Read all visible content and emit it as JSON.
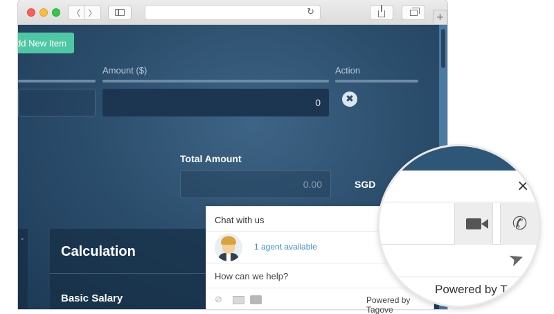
{
  "browser": {
    "nav_back_glyph": "〈",
    "nav_forward_glyph": "〉",
    "reload_glyph": "↻",
    "new_tab_glyph": "+"
  },
  "page": {
    "add_button_label": "dd New Item",
    "columns": {
      "amount_label": "Amount ($)",
      "action_label": "Action"
    },
    "amount_value": "0",
    "remove_icon_glyph": "✖",
    "total_label": "Total Amount",
    "total_value": "0.00",
    "currency": "SGD",
    "calc_title": "Calculation",
    "basic_salary_label": "Basic Salary",
    "panel_arrow_glyph": "⌄"
  },
  "chat": {
    "title": "Chat with us",
    "agent_status": "1 agent available",
    "help_prompt": "How can we help?",
    "powered_by": "Powered by Tagove",
    "attach_glyph": "⊘"
  },
  "magnifier": {
    "close_glyph": "×",
    "phone_glyph": "✆",
    "send_glyph": "➤",
    "powered_by": "Powered by T"
  },
  "colors": {
    "accent_green": "#4ec8a4",
    "link_blue": "#3d8fd6",
    "page_bg": "#2b4d6c"
  },
  "icons": [
    "close-icon",
    "video-icon",
    "phone-icon",
    "send-icon",
    "attachment-icon",
    "mail-icon",
    "print-icon",
    "reload-icon",
    "share-icon",
    "tabs-icon",
    "sidebar-icon",
    "remove-icon"
  ]
}
